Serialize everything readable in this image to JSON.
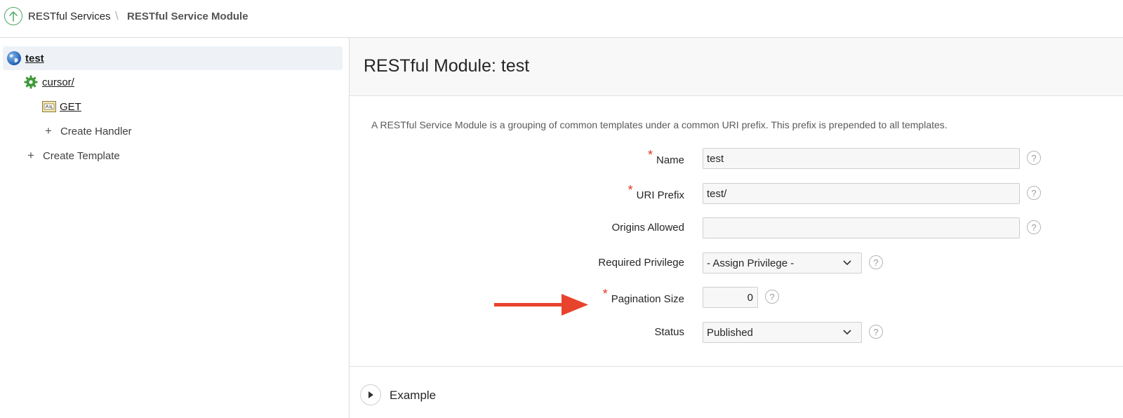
{
  "breadcrumb": {
    "parent_label": "RESTful Services",
    "separator": "\\",
    "current_label": "RESTful Service Module"
  },
  "tree": {
    "module": {
      "label": "test",
      "icon": "globe-icon"
    },
    "template": {
      "label": "cursor/",
      "icon": "gear-icon"
    },
    "handler": {
      "label": "GET",
      "icon": "handler-icon"
    },
    "create_handler": "Create Handler",
    "create_template": "Create Template"
  },
  "panel": {
    "title": "RESTful Module: test",
    "description": "A RESTful Service Module is a grouping of common templates under a common URI prefix. This prefix is prepended to all templates."
  },
  "form": {
    "required_mark": "*",
    "help_glyph": "?",
    "name": {
      "label": "Name",
      "value": "test"
    },
    "uri_prefix": {
      "label": "URI Prefix",
      "value": "test/"
    },
    "origins": {
      "label": "Origins Allowed",
      "value": ""
    },
    "privilege": {
      "label": "Required Privilege",
      "value": "- Assign Privilege -"
    },
    "pagination": {
      "label": "Pagination Size",
      "value": "0"
    },
    "status": {
      "label": "Status",
      "value": "Published"
    }
  },
  "example": {
    "label": "Example"
  },
  "colors": {
    "accent_green": "#4fa865",
    "required_red": "#e0362a",
    "annotation_arrow": "#e8432d",
    "selected_row_bg": "#eef2f7"
  }
}
